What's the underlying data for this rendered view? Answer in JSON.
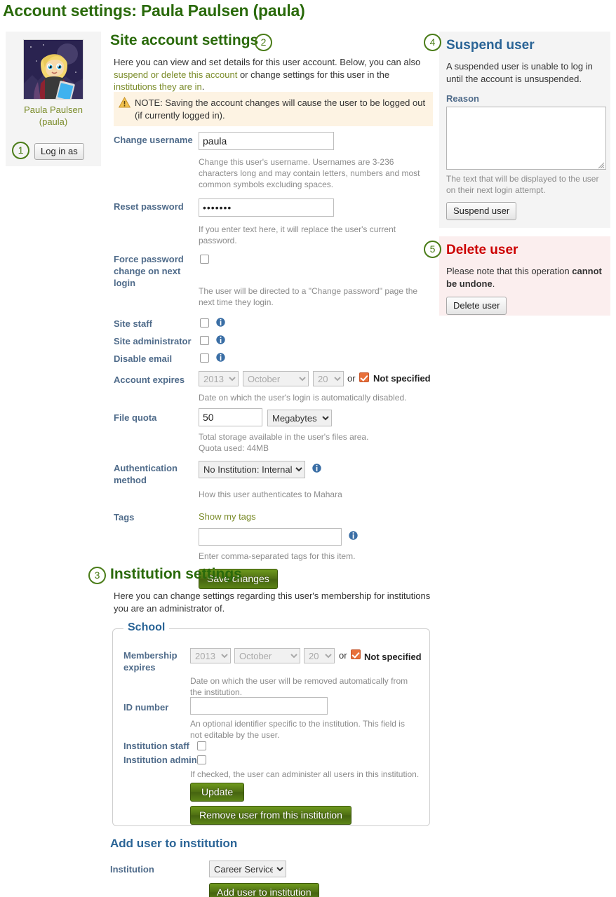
{
  "page": {
    "title": "Account settings: Paula Paulsen (paula)"
  },
  "profile": {
    "name": "Paula Paulsen",
    "username": "(paula)",
    "login_as_label": "Log in as",
    "avatar_icon": "user-avatar-image"
  },
  "steps": {
    "one": "1",
    "two": "2",
    "three": "3",
    "four": "4",
    "five": "5"
  },
  "site_account": {
    "heading": "Site account settings",
    "intro_a": "Here you can view and set details for this user account. Below, you can also ",
    "intro_link1": "suspend or delete this account",
    "intro_b": " or change settings for this user in the ",
    "intro_link2": "institutions they are in",
    "intro_c": ".",
    "note": "NOTE: Saving the account changes will cause the user to be logged out (if currently logged in).",
    "fields": {
      "change_username": {
        "label": "Change username",
        "value": "paula",
        "help": "Change this user's username. Usernames are 3-236 characters long and may contain letters, numbers and most common symbols excluding spaces."
      },
      "reset_password": {
        "label": "Reset password",
        "value": "•••••••",
        "help": "If you enter text here, it will replace the user's current password."
      },
      "force_password_change": {
        "label": "Force password change on next login",
        "checked": false,
        "help": "The user will be directed to a \"Change password\" page the next time they login."
      },
      "site_staff": {
        "label": "Site staff",
        "checked": false,
        "info_icon": "info-icon"
      },
      "site_administrator": {
        "label": "Site administrator",
        "checked": false,
        "info_icon": "info-icon"
      },
      "disable_email": {
        "label": "Disable email",
        "checked": false,
        "info_icon": "info-icon"
      },
      "account_expires": {
        "label": "Account expires",
        "year": "2013",
        "month": "October",
        "day": "20",
        "or_text": "or",
        "not_specified_label": "Not specified",
        "not_specified_checked": true,
        "help": "Date on which the user's login is automatically disabled."
      },
      "file_quota": {
        "label": "File quota",
        "value": "50",
        "unit": "Megabytes",
        "help_line1": "Total storage available in the user's files area.",
        "help_line2": "Quota used: 44MB"
      },
      "authentication_method": {
        "label": "Authentication method",
        "value": "No Institution: Internal",
        "help": "How this user authenticates to Mahara",
        "info_icon": "info-icon"
      },
      "tags": {
        "label": "Tags",
        "show_link": "Show my tags",
        "value": "",
        "help": "Enter comma-separated tags for this item.",
        "info_icon": "info-icon"
      }
    },
    "save_label": "Save changes"
  },
  "suspend": {
    "heading": "Suspend user",
    "description": "A suspended user is unable to log in until the account is unsuspended.",
    "reason_label": "Reason",
    "reason_value": "",
    "help": "The text that will be displayed to the user on their next login attempt.",
    "button_label": "Suspend user"
  },
  "delete": {
    "heading": "Delete user",
    "note_a": "Please note that this operation ",
    "note_strong": "cannot be undone",
    "note_b": ".",
    "button_label": "Delete user"
  },
  "institution_settings": {
    "heading": "Institution settings",
    "intro": "Here you can change settings regarding this user's membership for institutions you are an administrator of.",
    "fieldset_legend": "School",
    "membership_expires": {
      "label": "Membership expires",
      "year": "2013",
      "month": "October",
      "day": "20",
      "or_text": "or",
      "not_specified_label": "Not specified",
      "not_specified_checked": true,
      "help": "Date on which the user will be removed automatically from the institution."
    },
    "id_number": {
      "label": "ID number",
      "value": "",
      "help": "An optional identifier specific to the institution. This field is not editable by the user."
    },
    "institution_staff": {
      "label": "Institution staff",
      "checked": false
    },
    "institution_admin": {
      "label": "Institution admin",
      "checked": false,
      "help": "If checked, the user can administer all users in this institution."
    },
    "update_label": "Update",
    "remove_label": "Remove user from this institution"
  },
  "add_user": {
    "heading": "Add user to institution",
    "institution_label": "Institution",
    "institution_value": "Career Service",
    "button_label": "Add user to institution"
  },
  "colors": {
    "title_green": "#2a6a0b",
    "link_olive": "#7b8c2a",
    "label_blue": "#4f6b8a",
    "heading_blue": "#2a6496",
    "danger_red": "#cc0000",
    "checkbox_orange": "#e8703a",
    "note_bg": "#fdf3e3",
    "delete_bg": "#fbeeee",
    "card_bg": "#f4f4f4"
  }
}
